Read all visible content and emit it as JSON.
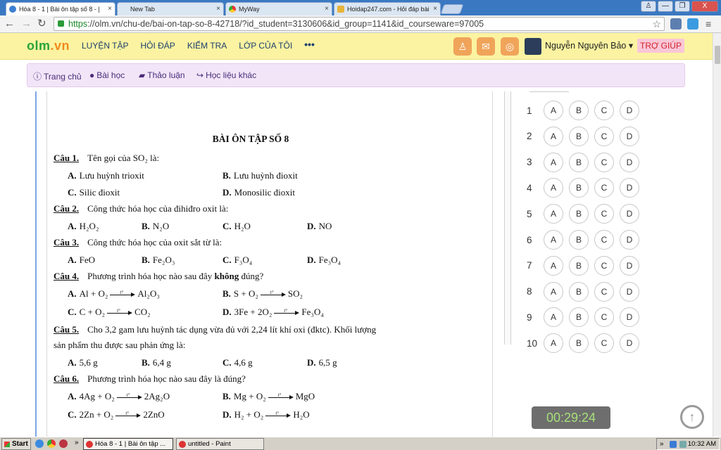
{
  "browser": {
    "tabs": [
      {
        "title": "Hóa 8 - 1 | Bài ôn tập số 8 - |",
        "active": true
      },
      {
        "title": "New Tab",
        "active": false
      },
      {
        "title": "MyWay",
        "active": false
      },
      {
        "title": "Hoidap247.com - Hỏi đáp bài",
        "active": false
      }
    ],
    "url_scheme": "https",
    "url_rest": "://olm.vn/chu-de/bai-on-tap-so-8-42718/?id_student=3130606&id_group=1141&id_courseware=97005",
    "tab_close": "×",
    "win_min": "—",
    "win_max": "❐",
    "win_close": "X"
  },
  "site": {
    "logo_a": "olm",
    "logo_b": ".vn",
    "nav": [
      "LUYỆN TẬP",
      "HỎI ĐÁP",
      "KIỂM TRA",
      "LỚP CỦA TÔI"
    ],
    "more": "•••",
    "user": "Nguyễn Nguyên Bảo ▾",
    "help": "TRỢ GIÚP"
  },
  "subnav": {
    "home": "Trang chủ",
    "lessons": "Bài học",
    "discussion": "Thảo luận",
    "materials": "Học liệu khác"
  },
  "doc": {
    "title": "BÀI ÔN TẬP SỐ 8",
    "q1": {
      "label": "Câu 1.",
      "text": "Tên gọi của SO₂ là:",
      "a": "Lưu huỳnh trioxit",
      "b": "Lưu huỳnh đioxit",
      "c": "Silic đioxit",
      "d": "Monosilic đioxit"
    },
    "q2": {
      "label": "Câu 2.",
      "text": "Công thức hóa học của đihiđro oxit là:",
      "a": "H₂O₂",
      "b": "N₂O",
      "c": "H₂O",
      "d": "NO"
    },
    "q3": {
      "label": "Câu 3.",
      "text": "Công thức hóa học của oxit sắt từ là:",
      "a": "FeO",
      "b": "Fe₂O₃",
      "c": "F₃O₄",
      "d": "Fe₃O₄"
    },
    "q4": {
      "label": "Câu 4.",
      "text_a": "Phương trình hóa học nào sau đây ",
      "text_bold": "không",
      "text_b": " đúng?",
      "a_l": "Al + O₂",
      "a_r": "Al₂O₃",
      "b_l": "S + O₂",
      "b_r": "SO₂",
      "c_l": "C + O₂",
      "c_r": "CO₂",
      "d_l": "3Fe + 2O₂",
      "d_r": "Fe₃O₄"
    },
    "q5": {
      "label": "Câu 5.",
      "text": "Cho 3,2 gam lưu huỳnh tác dụng vừa đủ với 2,24 lít khí oxi (đktc). Khối lượng",
      "text2": "sản phẩm thu được sau phản ứng là:",
      "a": "5,6 g",
      "b": "6,4 g",
      "c": "4,6 g",
      "d": "6,5 g"
    },
    "q6": {
      "label": "Câu 6.",
      "text": "Phương trình hóa học nào sau đây là đúng?",
      "a_l": "4Ag + O₂",
      "a_r": "2Ag₂O",
      "b_l": "Mg + O₂",
      "b_r": "MgO",
      "c_l": "2Zn + O₂",
      "c_r": "2ZnO",
      "d_l": "H₂ + O₂",
      "d_r": "H₂O"
    },
    "letters": {
      "a": "A.",
      "b": "B.",
      "c": "C.",
      "d": "D."
    },
    "arrow_label": "t°"
  },
  "answers": {
    "numbers": [
      "1",
      "2",
      "3",
      "4",
      "5",
      "6",
      "7",
      "8",
      "9",
      "10"
    ],
    "choices": [
      "A",
      "B",
      "C",
      "D"
    ]
  },
  "timer": "00:29:24",
  "taskbar": {
    "start": "Start",
    "chrome_item": "Hóa 8 - 1 | Bài ôn tập ...",
    "paint_item": "untitled - Paint",
    "time": "10:32 AM",
    "chevrons": "»"
  }
}
